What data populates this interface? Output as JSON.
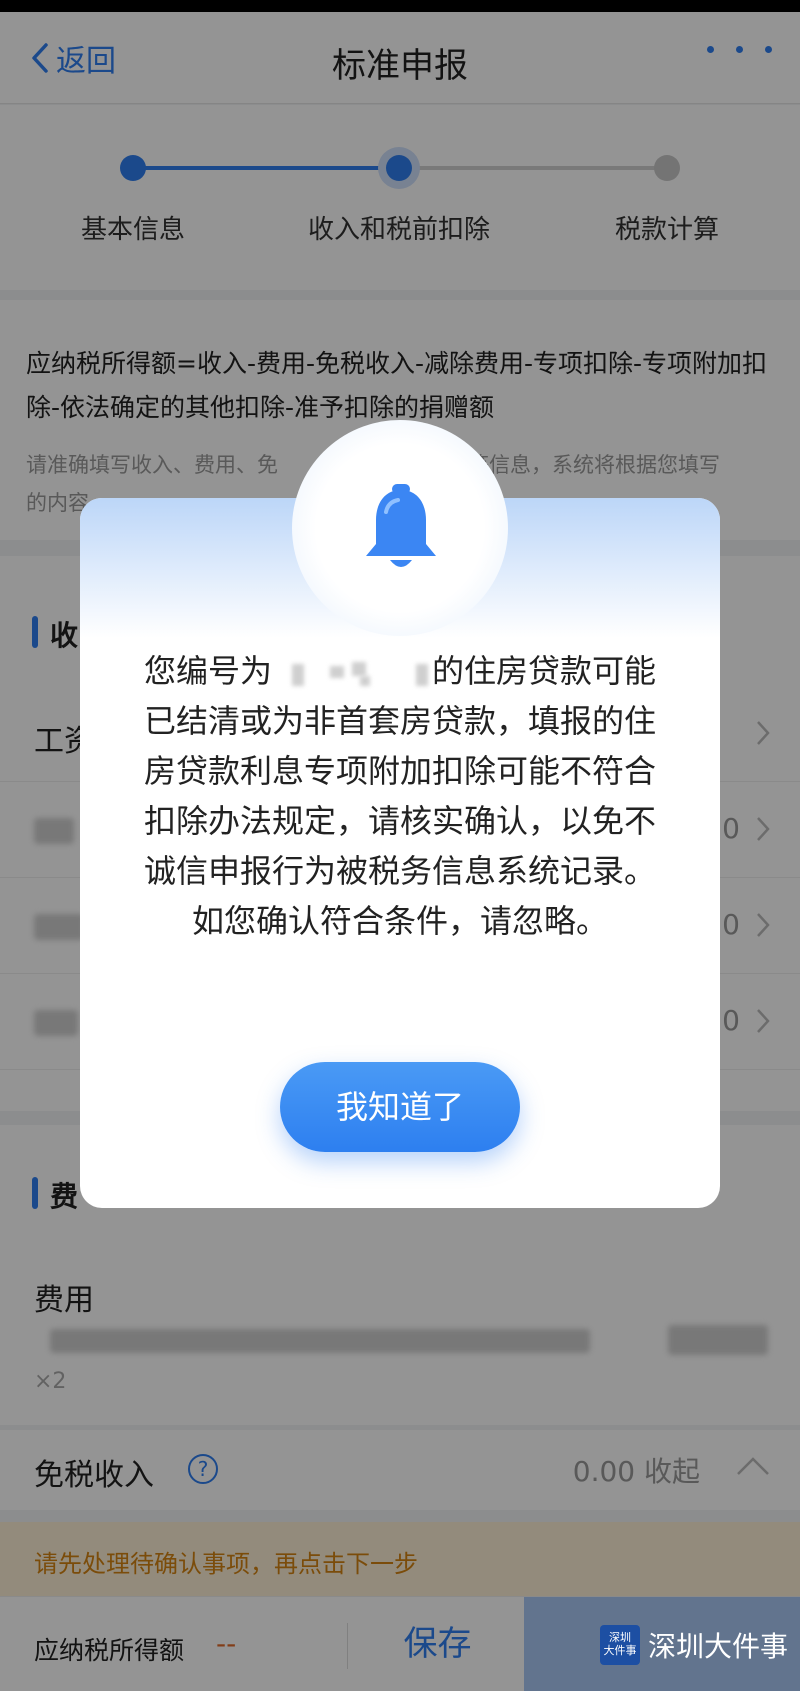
{
  "nav": {
    "back_label": "返回",
    "title": "标准申报",
    "more_icon": "more-dots-icon"
  },
  "stepper": {
    "steps": [
      {
        "label": "基本信息",
        "state": "done"
      },
      {
        "label": "收入和税前扣除",
        "state": "active"
      },
      {
        "label": "税款计算",
        "state": "pending"
      }
    ]
  },
  "formula": {
    "text": "应纳税所得额=收入-费用-免税收入-减除费用-专项扣除-专项附加扣除-依法确定的其他扣除-准予扣除的捐赠额",
    "note_start": "请准确填写收入、费用、免",
    "note_end": "等信息，系统将根据您填写",
    "note_line2": "的内容"
  },
  "income_section": {
    "header_fragment": "收",
    "row_label_fragment": "工资",
    "row_values": [
      "0",
      "0",
      "0"
    ]
  },
  "fee_section": {
    "header_fragment": "费",
    "row_label": "费用",
    "sub_fragment": "×2"
  },
  "exempt": {
    "label": "免税收入",
    "value": "0.00 收起",
    "help_icon": "question-circle-icon"
  },
  "warning": {
    "text": "请先处理待确认事项，再点击下一步"
  },
  "bottom": {
    "tax_label": "应纳税所得额",
    "tax_value": "--",
    "save_label": "保存"
  },
  "dialog": {
    "icon": "bell-icon",
    "msg_before": "您编号为",
    "msg_after": "的住房贷款可能已结清或为非首套房贷款，填报的住房贷款利息专项附加扣除可能不符合扣除办法规定，请核实确认，以免不诚信申报行为被税务信息系统记录。如您确认符合条件，请忽略。",
    "ok_label": "我知道了"
  },
  "watermark": {
    "logo_text": "深圳大件事",
    "text": "深圳大件事"
  },
  "colors": {
    "accent": "#2f7ff0",
    "warning": "#d48412",
    "overlay": "rgba(0,0,0,0.42)"
  }
}
